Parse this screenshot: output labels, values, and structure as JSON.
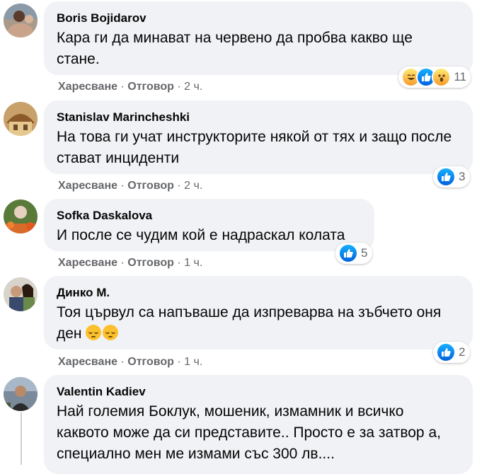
{
  "colors": {
    "bubble": "#f0f2f5",
    "secondary_text": "#65676b",
    "like_blue": "#1877f2",
    "haha_yellow": "#f7b928"
  },
  "comments": [
    {
      "author": "Boris Bojidarov",
      "text": "Кара ги да минават на червено да пробва какво ще стане.",
      "like_label": "Харесване",
      "reply_label": "Отговор",
      "time": "2 ч.",
      "reactions": [
        "haha-icon",
        "like-icon",
        "wow-icon"
      ],
      "reaction_count": "11"
    },
    {
      "author": "Stanislav Marincheshki",
      "text": "На това ги учат инструкторите някой от тях и защо после стават инциденти",
      "like_label": "Харесване",
      "reply_label": "Отговор",
      "time": "2 ч.",
      "reactions": [
        "like-icon"
      ],
      "reaction_count": "3"
    },
    {
      "author": "Sofka Daskalova",
      "text": "И после се чудим кой е надраскал колата",
      "like_label": "Харесване",
      "reply_label": "Отговор",
      "time": "1 ч.",
      "reactions": [
        "like-icon"
      ],
      "reaction_count": "5"
    },
    {
      "author": "Динко М.",
      "text": "Тоя цървул са напъваше да изпреварва на зъбчето оня ден",
      "emojis": [
        "relieved-face-icon",
        "relieved-face-icon"
      ],
      "like_label": "Харесване",
      "reply_label": "Отговор",
      "time": "1 ч.",
      "reactions": [
        "like-icon"
      ],
      "reaction_count": "2"
    },
    {
      "author": "Valentin Kadiev",
      "text": "Най големия Боклук, мошеник, измамник и всичко каквото може да си представите.. Просто е за затвор а, специално мен ме измами със 300 лв...."
    }
  ],
  "separator": "·"
}
